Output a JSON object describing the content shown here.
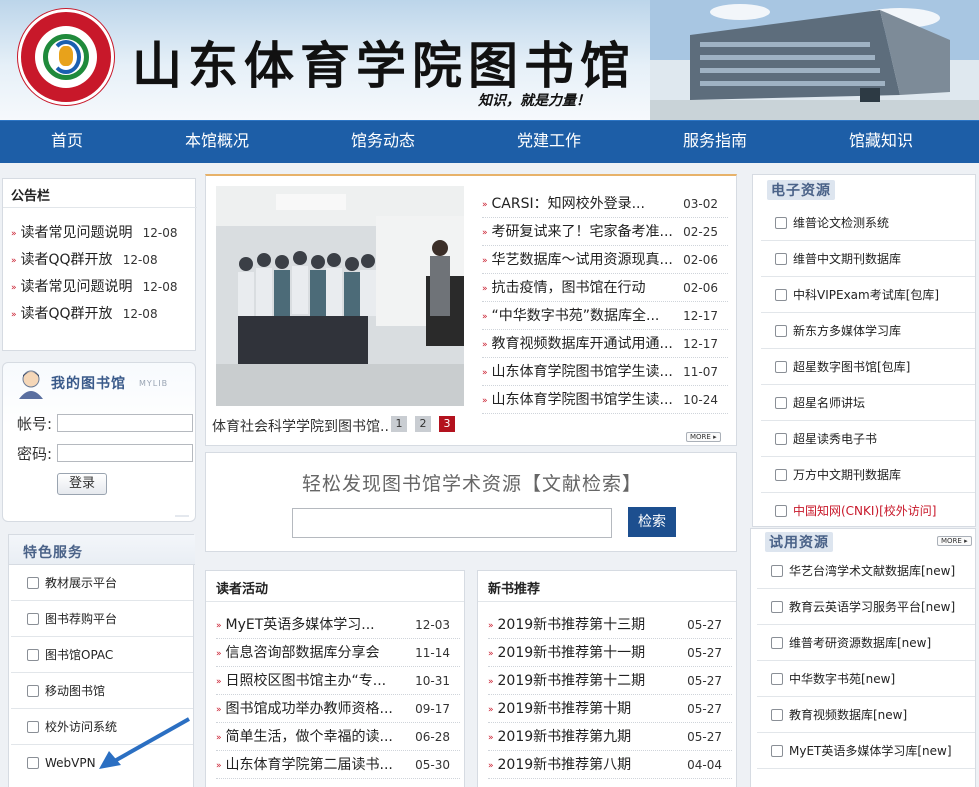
{
  "header": {
    "title": "山东体育学院图书馆",
    "slogan": "知识，就是力量！"
  },
  "nav": [
    "首页",
    "本馆概况",
    "馆务动态",
    "党建工作",
    "服务指南",
    "馆藏知识"
  ],
  "notice": {
    "title": "公告栏",
    "items": [
      {
        "text": "读者常见问题说明",
        "date": "12-08"
      },
      {
        "text": "读者QQ群开放",
        "date": "12-08"
      },
      {
        "text": "读者常见问题说明",
        "date": "12-08"
      },
      {
        "text": "读者QQ群开放",
        "date": "12-08"
      }
    ]
  },
  "my_library": {
    "title": "我的图书馆",
    "subtitle": "MYLIB",
    "account_label": "帐号:",
    "password_label": "密码:",
    "login_label": "登录"
  },
  "special": {
    "title": "特色服务",
    "items": [
      "教材展示平台",
      "图书荐购平台",
      "图书馆OPAC",
      "移动图书馆",
      "校外访问系统",
      "WebVPN"
    ]
  },
  "news": {
    "caption": "体育社会科学学院到图书馆..",
    "pages": [
      "1",
      "2",
      "3"
    ],
    "more": "MORE",
    "items": [
      {
        "text": "CARSI：知网校外登录...",
        "date": "03-02"
      },
      {
        "text": "考研复试来了！宅家备考准...",
        "date": "02-25"
      },
      {
        "text": "华艺数据库～试用资源现真...",
        "date": "02-06"
      },
      {
        "text": "抗击疫情，图书馆在行动",
        "date": "02-06"
      },
      {
        "text": "“中华数字书苑”数据库全...",
        "date": "12-17"
      },
      {
        "text": "教育视频数据库开通试用通...",
        "date": "12-17"
      },
      {
        "text": "山东体育学院图书馆学生读...",
        "date": "11-07"
      },
      {
        "text": "山东体育学院图书馆学生读...",
        "date": "10-24"
      }
    ]
  },
  "search": {
    "heading": "轻松发现图书馆学术资源【文献检索】",
    "button": "检索"
  },
  "activities": {
    "title": "读者活动",
    "items": [
      {
        "text": "MyET英语多媒体学习...",
        "date": "12-03"
      },
      {
        "text": "信息咨询部数据库分享会",
        "date": "11-14"
      },
      {
        "text": "日照校区图书馆主办“专...",
        "date": "10-31"
      },
      {
        "text": "图书馆成功举办教师资格...",
        "date": "09-17"
      },
      {
        "text": "简单生活，做个幸福的读...",
        "date": "06-28"
      },
      {
        "text": "山东体育学院第二届读书...",
        "date": "05-30"
      }
    ]
  },
  "newbooks": {
    "title": "新书推荐",
    "items": [
      {
        "text": "2019新书推荐第十三期",
        "date": "05-27"
      },
      {
        "text": "2019新书推荐第十一期",
        "date": "05-27"
      },
      {
        "text": "2019新书推荐第十二期",
        "date": "05-27"
      },
      {
        "text": "2019新书推荐第十期",
        "date": "05-27"
      },
      {
        "text": "2019新书推荐第九期",
        "date": "05-27"
      },
      {
        "text": "2019新书推荐第八期",
        "date": "04-04"
      }
    ]
  },
  "eresources": {
    "title": "电子资源",
    "items": [
      "维普论文检测系统",
      "维普中文期刊数据库",
      "中科VIPExam考试库[包库]",
      "新东方多媒体学习库",
      "超星数字图书馆[包库]",
      "超星名师讲坛",
      "超星读秀电子书",
      "万方中文期刊数据库",
      "中国知网(CNKI)[校外访问]"
    ],
    "highlight_color": "#c8182a"
  },
  "trial": {
    "title": "试用资源",
    "more": "MORE",
    "items": [
      "华艺台湾学术文献数据库[new]",
      "教育云英语学习服务平台[new]",
      "维普考研资源数据库[new]",
      "中华数字书苑[new]",
      "教育视频数据库[new]",
      "MyET英语多媒体学习库[new]"
    ]
  }
}
